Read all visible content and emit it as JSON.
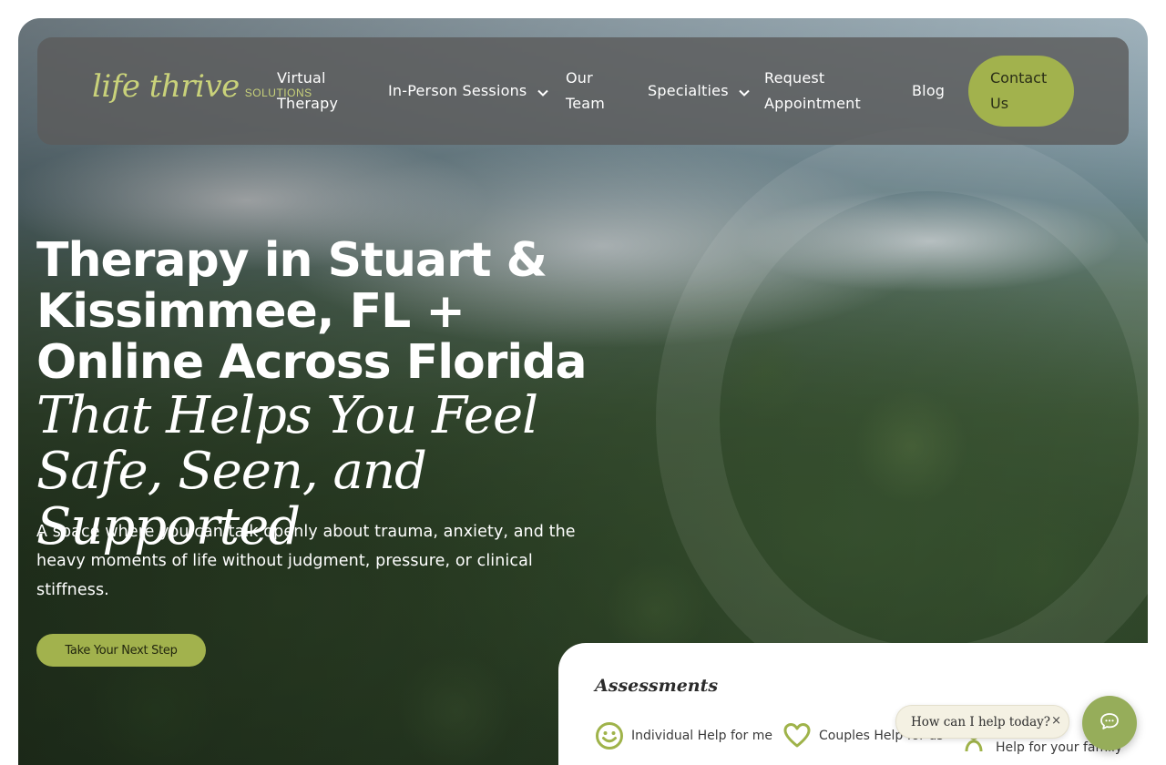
{
  "brand": {
    "logo_main": "life thrive",
    "logo_sub": "SOLUTIONS",
    "accent_color": "#a2b24d"
  },
  "nav": {
    "virtual_therapy_line1": "Virtual",
    "virtual_therapy_line2": "Therapy",
    "in_person": "In-Person Sessions",
    "our_team_line1": "Our",
    "our_team_line2": "Team",
    "specialties": "Specialties",
    "request_line1": "Request",
    "request_line2": "Appointment",
    "blog": "Blog",
    "contact_line1": "Contact",
    "contact_line2": "Us"
  },
  "hero": {
    "headline": "Therapy in Stuart & Kissimmee, FL + Online Across Florida",
    "headline_italic": "That Helps You Feel Safe, Seen, and Supported",
    "subtext": "A space where you can talk openly about trauma, anxiety, and the heavy moments of life without judgment, pressure, or clinical stiffness.",
    "cta": "Take Your Next Step"
  },
  "assessments": {
    "title": "Assessments",
    "items": [
      {
        "label": "Individual Help for me",
        "icon": "smiley-icon"
      },
      {
        "label": "Couples Help for us",
        "icon": "heart-icon"
      },
      {
        "label": "Help for your family",
        "icon": "family-icon"
      }
    ]
  },
  "chat": {
    "prompt": "How can I help today?",
    "close": "×",
    "launcher_icon": "chat-icon"
  }
}
